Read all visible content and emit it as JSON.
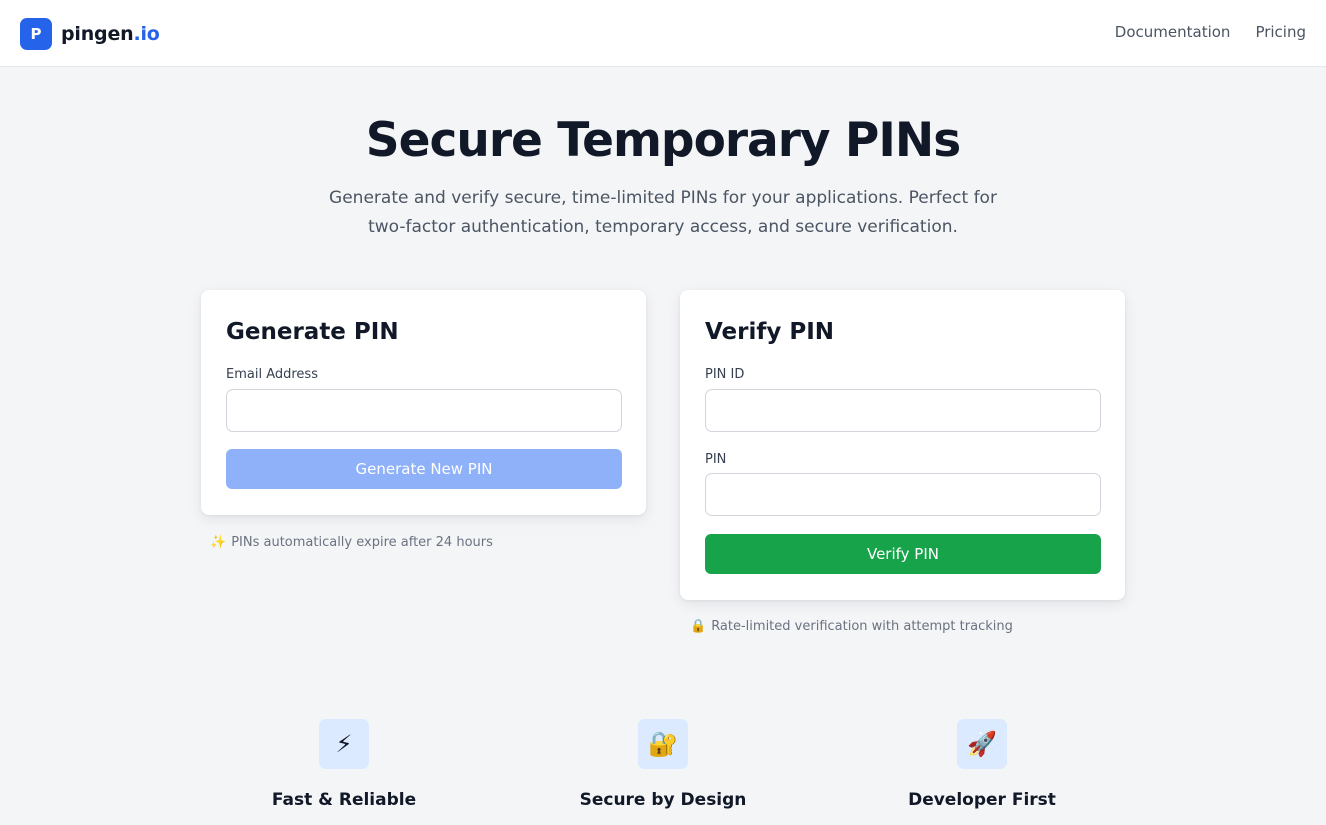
{
  "header": {
    "logo_letter": "P",
    "logo_name": "pingen",
    "logo_tld": ".io",
    "nav": [
      "Documentation",
      "Pricing"
    ]
  },
  "hero": {
    "title": "Secure Temporary PINs",
    "subtitle_line1": "Generate and verify secure, time-limited PINs for your applications. Perfect for",
    "subtitle_line2": "two-factor authentication, temporary access, and secure verification."
  },
  "generate": {
    "title": "Generate PIN",
    "email_label": "Email Address",
    "email_value": "",
    "email_placeholder": "",
    "button": "Generate New PIN",
    "note_icon": "✨",
    "note": "PINs automatically expire after 24 hours"
  },
  "verify": {
    "title": "Verify PIN",
    "pin_id_label": "PIN ID",
    "pin_id_value": "",
    "pin_label": "PIN",
    "pin_value": "",
    "button": "Verify PIN",
    "note_icon": "🔒",
    "note": "Rate-limited verification with attempt tracking"
  },
  "features": [
    {
      "icon": "⚡",
      "icon_name": "lightning-icon",
      "title": "Fast & Reliable"
    },
    {
      "icon": "🔐",
      "icon_name": "lock-key-icon",
      "title": "Secure by Design"
    },
    {
      "icon": "🚀",
      "icon_name": "rocket-icon",
      "title": "Developer First"
    }
  ],
  "colors": {
    "brand": "#2563eb",
    "generate_button_disabled": "#8fb1f9",
    "verify_button": "#16a34a",
    "feature_icon_bg": "#dbeafe",
    "page_bg": "#f4f5f7"
  }
}
